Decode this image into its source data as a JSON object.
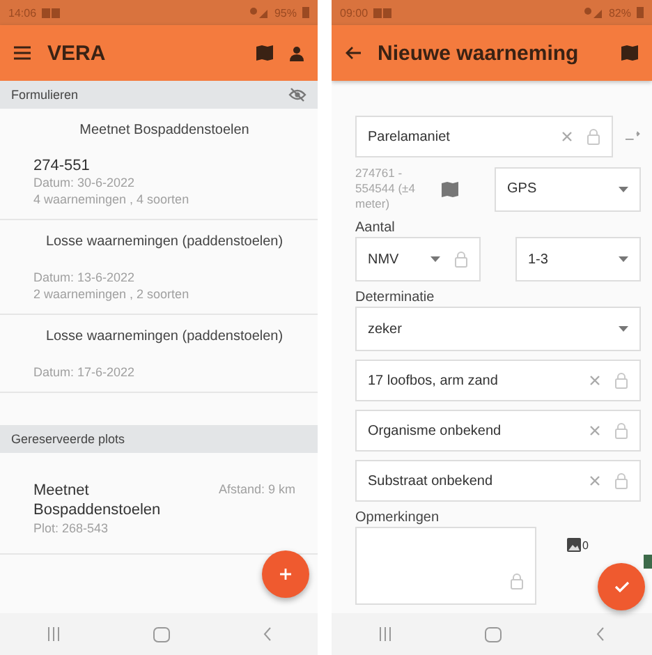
{
  "list_screen": {
    "status_bar": {
      "time": "14:06",
      "battery": "95%"
    },
    "app_bar": {
      "title": "VERA"
    },
    "forms_section": {
      "title": "Formulieren",
      "items": [
        {
          "heading": "Meetnet Bospaddenstoelen",
          "code": "274-551",
          "date": "Datum: 30-6-2022",
          "summary": "4 waarnemingen , 4 soorten"
        },
        {
          "heading": "Losse waarnemingen (paddenstoelen)",
          "date": "Datum: 13-6-2022",
          "summary": "2 waarnemingen , 2 soorten"
        },
        {
          "heading": "Losse waarnemingen (paddenstoelen)",
          "date": "Datum: 17-6-2022"
        }
      ]
    },
    "plots_section": {
      "title": "Gereserveerde plots",
      "items": [
        {
          "name": "Meetnet Bospaddenstoelen",
          "distance": "Afstand: 9 km",
          "plot": "Plot: 268-543"
        }
      ]
    }
  },
  "form_screen": {
    "status_bar": {
      "time": "09:00",
      "battery": "82%"
    },
    "app_bar": {
      "title": "Nieuwe waarneming"
    },
    "species": {
      "value": "Parelamaniet"
    },
    "location": {
      "coords": "274761 - 554544 (±4 meter)",
      "source": "GPS"
    },
    "count": {
      "label": "Aantal",
      "unit": "NMV",
      "range": "1-3"
    },
    "determination": {
      "label": "Determinatie",
      "value": "zeker"
    },
    "text_fields": [
      {
        "value": "17 loofbos, arm zand"
      },
      {
        "value": "Organisme onbekend"
      },
      {
        "value": "Substraat onbekend"
      }
    ],
    "remarks": {
      "label": "Opmerkingen"
    },
    "photo_count": "0"
  }
}
